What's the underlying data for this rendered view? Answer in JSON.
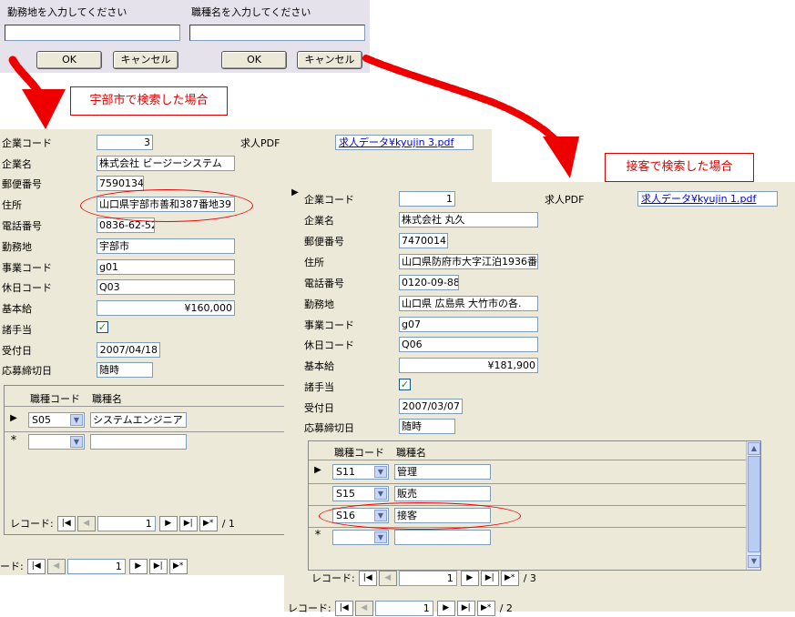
{
  "prompts": {
    "location": {
      "title": "勤務地を入力してください",
      "value": "",
      "ok": "OK",
      "cancel": "キャンセル"
    },
    "job": {
      "title": "職種名を入力してください",
      "value": "",
      "ok": "OK",
      "cancel": "キャンセル"
    }
  },
  "callouts": {
    "ube": "宇部市で検索した場合",
    "service": "接客で検索した場合"
  },
  "labels": {
    "company_code": "企業コード",
    "company_name": "企業名",
    "postal": "郵便番号",
    "address": "住所",
    "phone": "電話番号",
    "workplace": "勤務地",
    "business_code": "事業コード",
    "holiday_code": "休日コード",
    "base_salary": "基本給",
    "allowance": "諸手当",
    "received": "受付日",
    "deadline": "応募締切日",
    "pdf": "求人PDF",
    "job_code": "職種コード",
    "job_name": "職種名",
    "record": "レコード:"
  },
  "form1": {
    "company_code": "3",
    "pdf_link": "求人データ¥kyujin 3.pdf",
    "company_name": "株式会社 ビージーシステム",
    "postal": "7590134",
    "address": "山口県宇部市善和387番地39",
    "phone": "0836-62-52",
    "workplace": "宇部市",
    "business_code": "g01",
    "holiday_code": "Q03",
    "base_salary": "¥160,000",
    "received": "2007/04/18",
    "deadline": "随時",
    "jobs": [
      {
        "code": "S05",
        "name": "システムエンジニア"
      }
    ],
    "sub_record": "1",
    "sub_total": "/ 1",
    "main_record": "1"
  },
  "form2": {
    "company_code": "1",
    "pdf_link": "求人データ¥kyujin 1.pdf",
    "company_name": "株式会社 丸久",
    "postal": "7470014",
    "address": "山口県防府市大字江泊1936番",
    "phone": "0120-09-88",
    "workplace": "山口県 広島県 大竹市の各.",
    "business_code": "g07",
    "holiday_code": "Q06",
    "base_salary": "¥181,900",
    "received": "2007/03/07",
    "deadline": "随時",
    "jobs": [
      {
        "code": "S11",
        "name": "管理"
      },
      {
        "code": "S15",
        "name": "販売"
      },
      {
        "code": "S16",
        "name": "接客"
      }
    ],
    "sub_record": "1",
    "sub_total": "/ 3",
    "main_record": "1",
    "main_total": "/ 2"
  },
  "colors": {
    "arrow": "#ee0000",
    "form_bg": "#ece9d8",
    "prompt_bg": "#e6e2ec"
  }
}
